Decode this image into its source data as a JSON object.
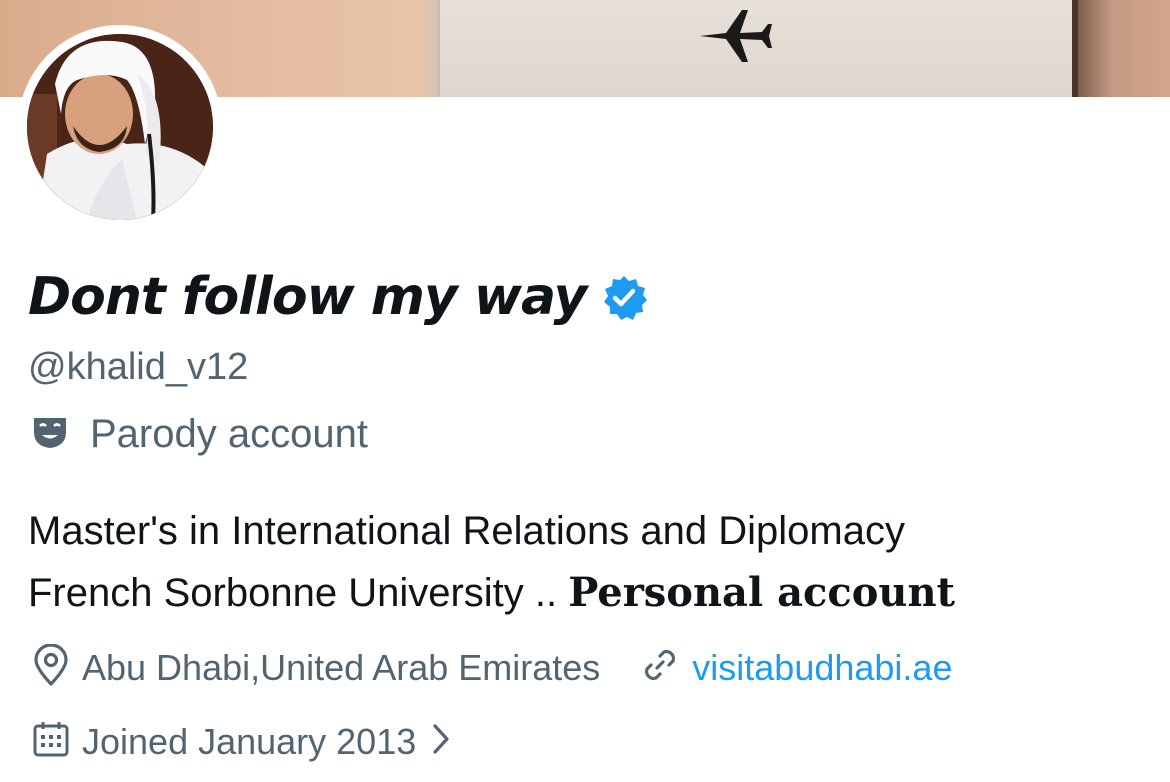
{
  "profile": {
    "display_name": "Dont follow my way",
    "handle": "@khalid_v12",
    "parody_label": "Parody account",
    "bio_line1": "Master's in International Relations and Diplomacy",
    "bio_line2_plain": "French Sorbonne University .. ",
    "bio_line2_bold": "Personal account",
    "location": "Abu Dhabi,United Arab Emirates",
    "website": "visitabudhabi.ae",
    "joined": "Joined January 2013"
  },
  "icons": {
    "verified": "verified-badge-icon",
    "parody": "theater-mask-icon",
    "location": "location-pin-icon",
    "link": "link-icon",
    "calendar": "calendar-icon",
    "chevron": "chevron-right-icon",
    "banner_plane": "airplane-icon"
  },
  "colors": {
    "text_primary": "#0f1419",
    "text_secondary": "#536471",
    "link": "#1d9bf0",
    "verified": "#1d9bf0"
  }
}
